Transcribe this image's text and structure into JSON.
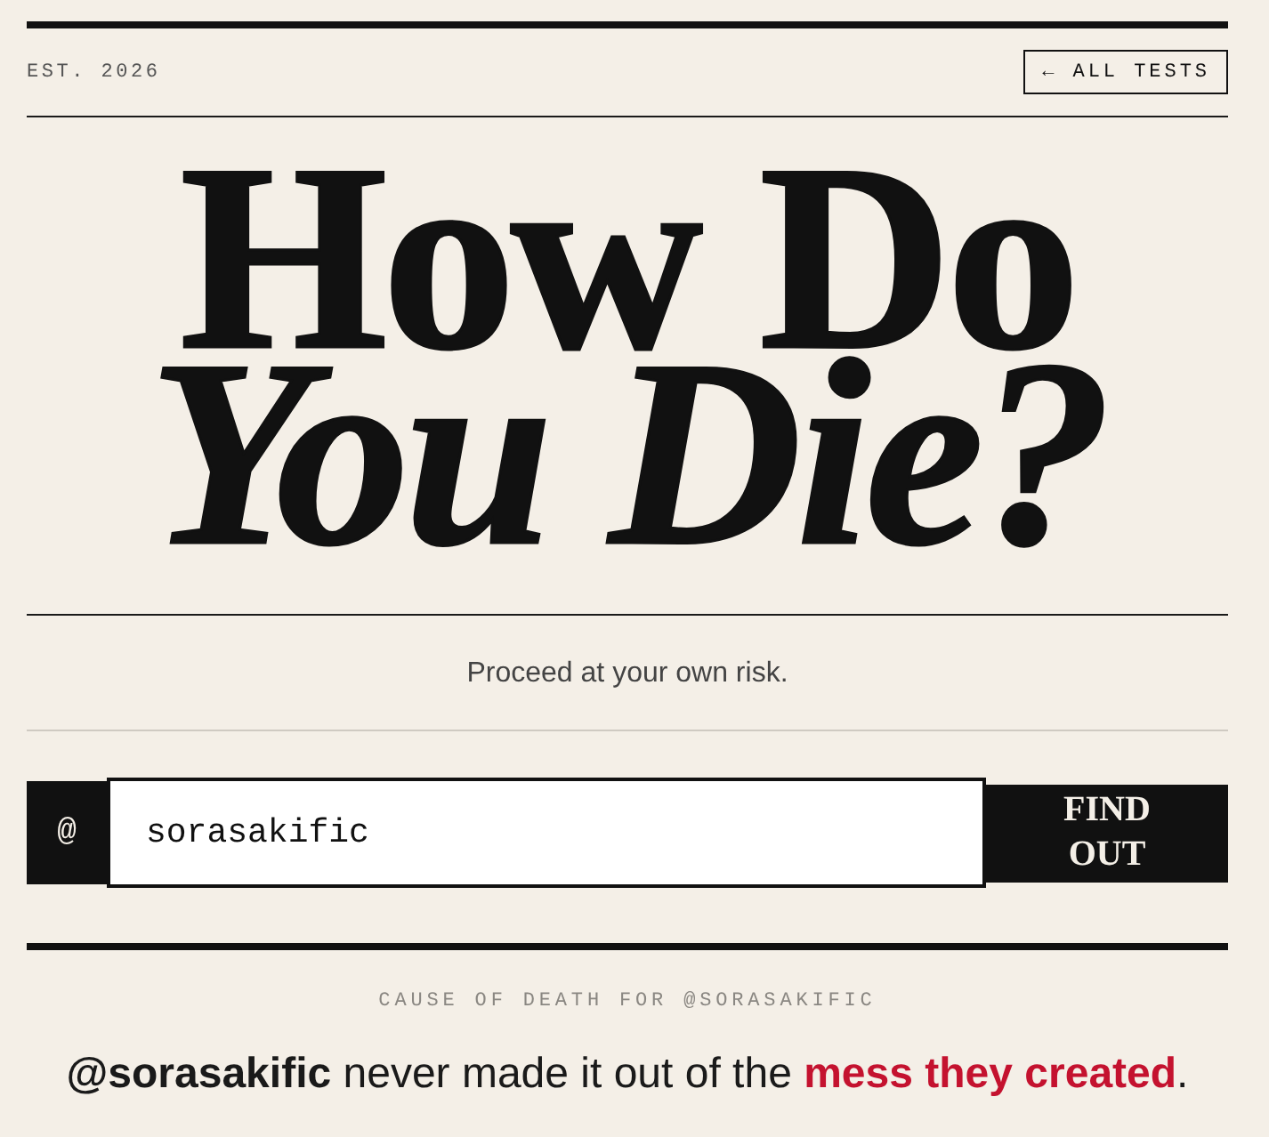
{
  "header": {
    "established": "EST. 2026",
    "back_button": "← ALL TESTS"
  },
  "title": {
    "lines": [
      {
        "text": "How Do",
        "kind": "upright"
      },
      {
        "text": "You Die?",
        "kind": "italic"
      }
    ]
  },
  "tagline": "Proceed at your own risk.",
  "search": {
    "prefix": "@",
    "value": "sorasakific",
    "button": "FIND OUT"
  },
  "result": {
    "label": "CAUSE OF DEATH FOR @SORASAKIFIC",
    "sentence": [
      {
        "text": "@sorasakific",
        "kind": "handle"
      },
      {
        "text": " never made it out of the ",
        "kind": "plain"
      },
      {
        "text": "mess they created",
        "kind": "cause"
      },
      {
        "text": ".",
        "kind": "plain"
      }
    ]
  }
}
